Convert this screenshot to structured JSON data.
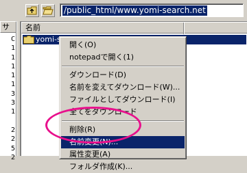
{
  "toolbar": {
    "buttons": [
      {
        "icon": "folder-up-icon"
      },
      {
        "icon": "open-folder-icon"
      }
    ],
    "path": "/public_html/www.yomi-search.net"
  },
  "left_pane": {
    "header": "サ",
    "digits": [
      "C",
      "1",
      "1",
      "1",
      "1",
      "1",
      "3",
      "3",
      "1",
      "",
      "2",
      "2",
      "5",
      "2"
    ]
  },
  "file_list": {
    "column_header": "名前",
    "selected_file": "yomi-s"
  },
  "context_menu": {
    "items": [
      {
        "label": "開く(O)"
      },
      {
        "label": "notepadで開く(1)"
      },
      {
        "separator": true
      },
      {
        "label": "ダウンロード(D)"
      },
      {
        "label": "名前を変えてダウンロード(W)..."
      },
      {
        "label": "ファイルとしてダウンロード(I)"
      },
      {
        "label": "全てをダウンロード"
      },
      {
        "separator": true
      },
      {
        "label": "削除(R)"
      },
      {
        "label": "名前変更(N)...",
        "active": true
      },
      {
        "label": "属性変更(A)"
      },
      {
        "label": "フォルダ作成(K)..."
      }
    ]
  },
  "colors": {
    "selection": "#0a246a",
    "highlight_circle": "#e8108c",
    "chrome": "#d4d0c8"
  }
}
